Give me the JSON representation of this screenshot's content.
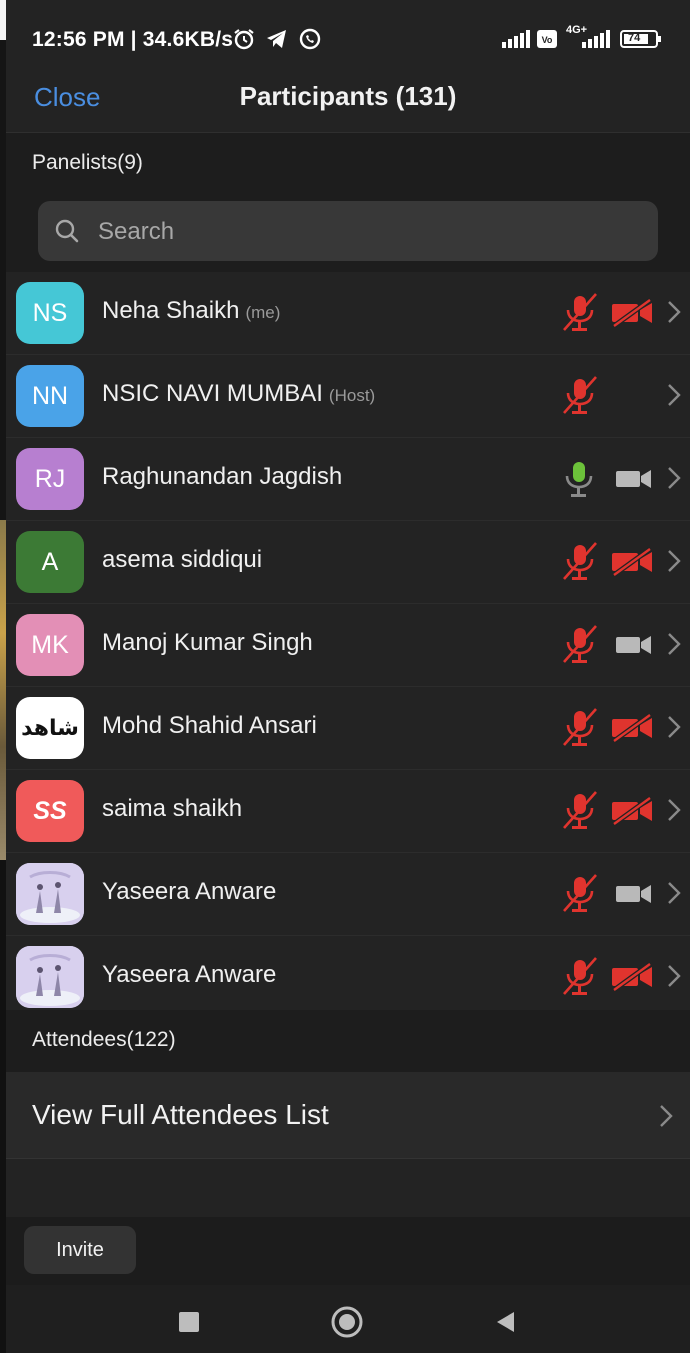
{
  "status_bar": {
    "time_speed": "12:56 PM | 34.6KB/s",
    "network_label": "4G+",
    "battery": "74",
    "icons": [
      "alarm-icon",
      "telegram-icon",
      "whatsapp-icon",
      "signal-icon",
      "volte-icon",
      "battery-icon"
    ]
  },
  "header": {
    "close_label": "Close",
    "title": "Participants (131)"
  },
  "panelists": {
    "header": "Panelists(9)"
  },
  "search": {
    "placeholder": "Search"
  },
  "participants": [
    {
      "initials": "NS",
      "name": "Neha Shaikh",
      "tag": "(me)",
      "avatar_color": "#45c7d6",
      "mic": "muted",
      "video": "off"
    },
    {
      "initials": "NN",
      "name": "NSIC NAVI MUMBAI",
      "tag": "(Host)",
      "avatar_color": "#4aa3e8",
      "mic": "muted",
      "video": "none"
    },
    {
      "initials": "RJ",
      "name": "Raghunandan Jagdish",
      "tag": "",
      "avatar_color": "#b77fd0",
      "mic": "on",
      "video": "on"
    },
    {
      "initials": "A",
      "name": "asema siddiqui",
      "tag": "",
      "avatar_color": "#3c7a35",
      "mic": "muted",
      "video": "off"
    },
    {
      "initials": "MK",
      "name": "Manoj Kumar Singh",
      "tag": "",
      "avatar_color": "#e38fb6",
      "mic": "muted",
      "video": "on"
    },
    {
      "initials": "شاهد",
      "name": "Mohd Shahid Ansari",
      "tag": "",
      "avatar_color": "#ffffff",
      "mic": "muted",
      "video": "off"
    },
    {
      "initials": "SS",
      "name": "saima shaikh",
      "tag": "",
      "avatar_color": "#f05a5a",
      "mic": "muted",
      "video": "off"
    },
    {
      "initials": "",
      "name": "Yaseera Anware",
      "tag": "",
      "avatar_color": "#cfc6e8",
      "mic": "muted",
      "video": "on"
    },
    {
      "initials": "",
      "name": "Yaseera Anware",
      "tag": "",
      "avatar_color": "#cfc6e8",
      "mic": "muted",
      "video": "off"
    }
  ],
  "attendees": {
    "header": "Attendees(122)",
    "view_full_label": "View Full Attendees List"
  },
  "footer": {
    "invite_label": "Invite"
  },
  "colors": {
    "accent": "#4a8ee0",
    "muted_red": "#e0342e",
    "mic_green": "#6cc23a",
    "background": "#232323"
  }
}
